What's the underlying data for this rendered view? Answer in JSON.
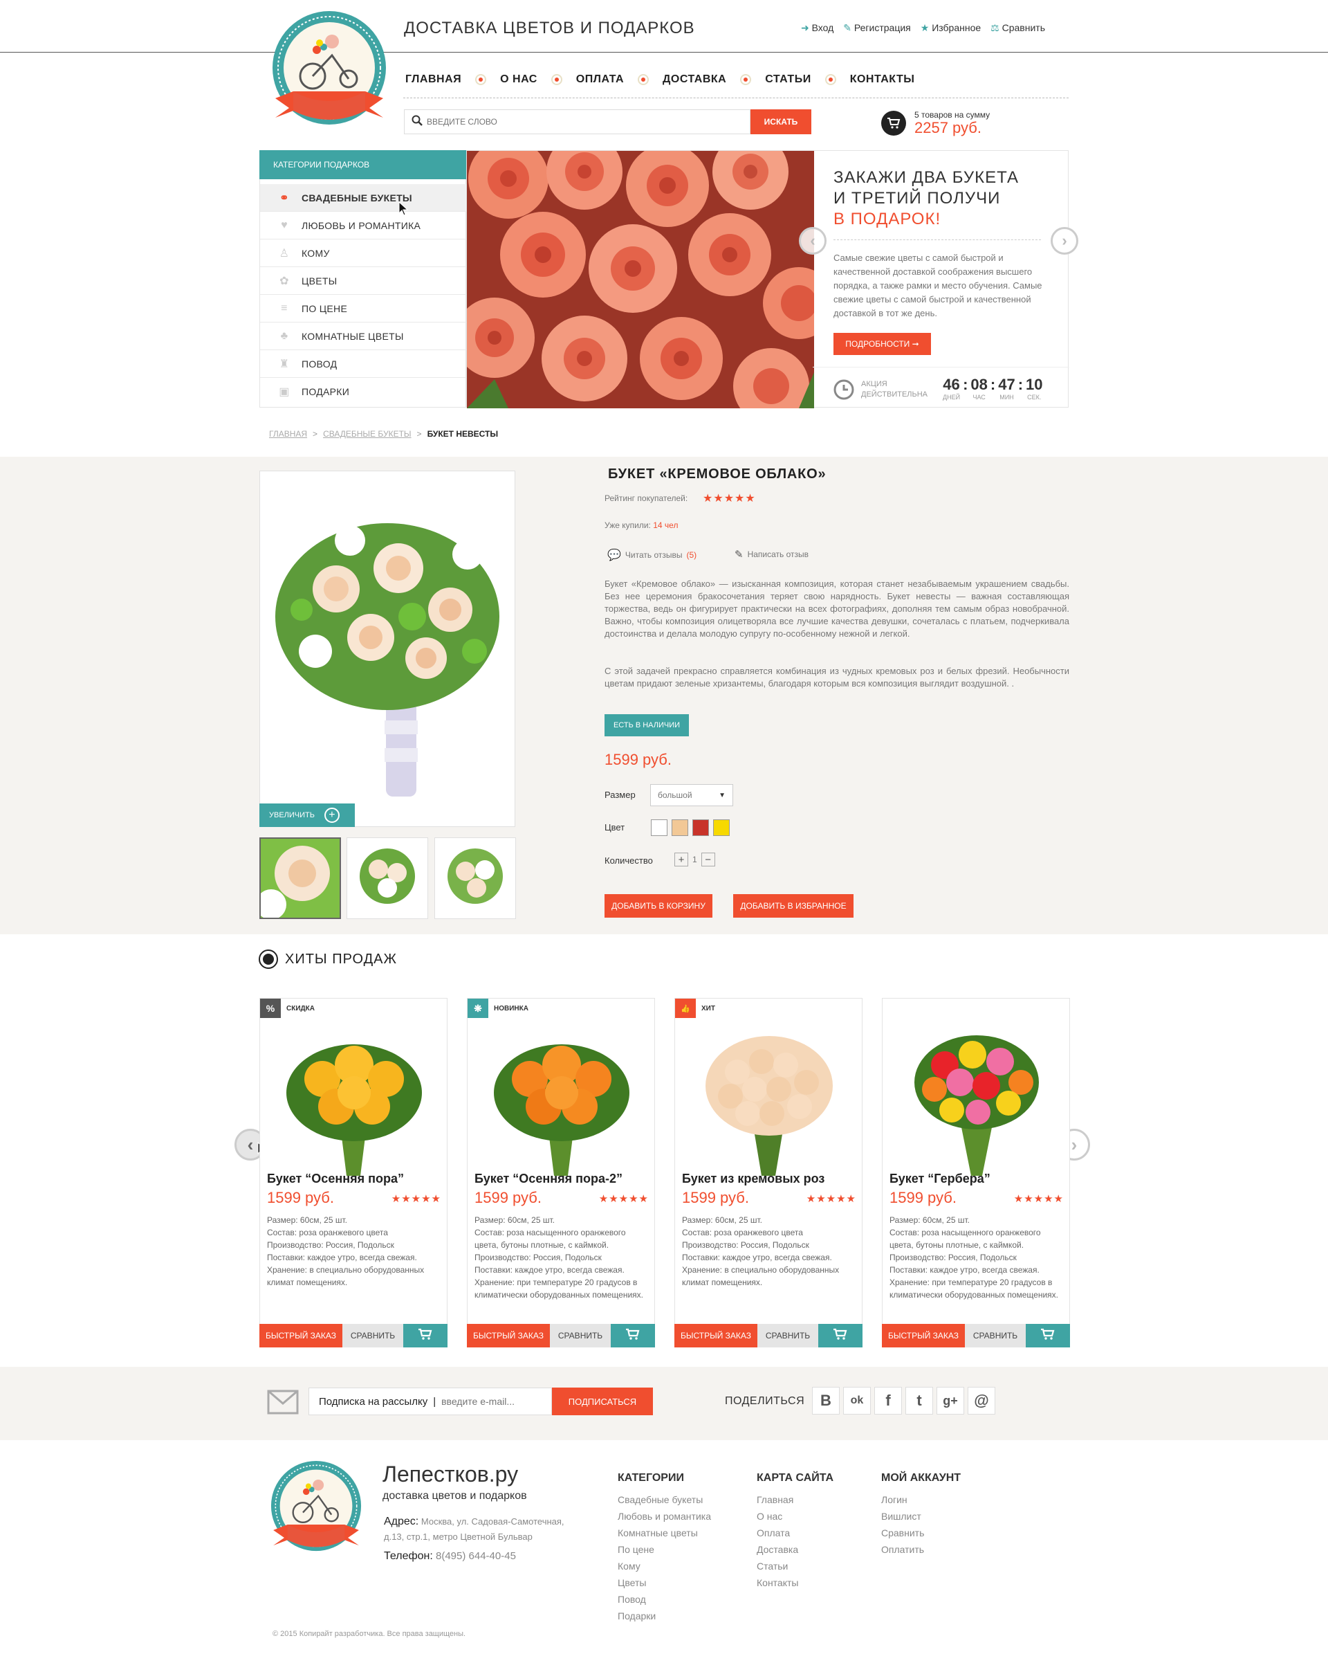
{
  "header": {
    "title": "ДОСТАВКА ЦВЕТОВ И ПОДАРКОВ",
    "links": [
      {
        "label": "Вход",
        "icon": "login-icon"
      },
      {
        "label": "Регистрация",
        "icon": "edit-icon"
      },
      {
        "label": "Избранное",
        "icon": "star-icon"
      },
      {
        "label": "Сравнить",
        "icon": "scales-icon"
      }
    ],
    "logo_text": "Лепестков.ру"
  },
  "nav": [
    "ГЛАВНАЯ",
    "О НАС",
    "ОПЛАТА",
    "ДОСТАВКА",
    "СТАТЬИ",
    "КОНТАКТЫ"
  ],
  "search": {
    "placeholder": "ВВЕДИТЕ СЛОВО",
    "button": "ИСКАТЬ"
  },
  "cart": {
    "summary": "5 товаров на сумму",
    "total": "2257 руб."
  },
  "categories": {
    "title": "КАТЕГОРИИ ПОДАРКОВ",
    "items": [
      "СВАДЕБНЫЕ БУКЕТЫ",
      "ЛЮБОВЬ И РОМАНТИКА",
      "КОМУ",
      "ЦВЕТЫ",
      "ПО ЦЕНЕ",
      "КОМНАТНЫЕ ЦВЕТЫ",
      "ПОВОД",
      "ПОДАРКИ"
    ]
  },
  "promo": {
    "line1": "ЗАКАЖИ ДВА БУКЕТА",
    "line2": "И ТРЕТИЙ ПОЛУЧИ",
    "line3": "В ПОДАРОК!",
    "text": "Самые свежие цветы с самой быстрой и качественной доставкой соображения высшего порядка, а также рамки и место обучения. Самые свежие цветы с самой быстрой и качественной доставкой в тот же день.",
    "button": "ПОДРОБНОСТИ ➞",
    "timer_label1": "АКЦИЯ",
    "timer_label2": "ДЕЙСТВИТЕЛЬНА",
    "days": "46",
    "hours": "08",
    "minutes": "47",
    "seconds": "10",
    "days_label": "ДНЕЙ",
    "hours_label": "ЧАС",
    "minutes_label": "МИН",
    "seconds_label": "СЕК."
  },
  "breadcrumb": {
    "home": "ГЛАВНАЯ",
    "cat": "СВАДЕБНЫЕ БУКЕТЫ",
    "current": "БУКЕТ НЕВЕСТЫ",
    "sep": ">"
  },
  "product": {
    "title": "БУКЕТ «КРЕМОВОЕ ОБЛАКО»",
    "rating_label": "Рейтинг покупателей:",
    "stars": "★★★★★",
    "bought_label": "Уже купили:",
    "bought_value": "14 чел",
    "reviews_label": "Читать отзывы",
    "reviews_count": "(5)",
    "write_review": "Написать отзыв",
    "desc1": "Букет «Кремовое облако» — изысканная композиция, которая станет незабываемым украшением свадьбы. Без нее церемония бракосочетания теряет свою нарядность. Букет невесты — важная составляющая торжества, ведь он фигурирует практически на всех фотографиях, дополняя тем самым образ новобрачной. Важно, чтобы композиция олицетворяла все лучшие качества девушки, сочеталась с платьем, подчеркивала достоинства и делала молодую супругу по-особенному нежной и легкой.",
    "desc2": "С этой задачей прекрасно справляется комбинация из чудных кремовых роз и белых фрезий. Необычности цветам придают зеленые хризантемы, благодаря которым вся композиция выглядит воздушной. .",
    "stock": "ЕСТЬ В НАЛИЧИИ",
    "price": "1599 руб.",
    "size_label": "Размер",
    "size_value": "большой",
    "color_label": "Цвет",
    "colors": [
      "#ffffff",
      "#f2c896",
      "#c8332a",
      "#f7d900"
    ],
    "qty_label": "Количество",
    "qty_plus": "+",
    "qty": "1",
    "qty_minus": "−",
    "add_cart": "ДОБАВИТЬ В КОРЗИНУ",
    "add_fav": "ДОБАВИТЬ В ИЗБРАННОЕ",
    "zoom": "УВЕЛИЧИТЬ"
  },
  "hits": {
    "title": "ХИТЫ ПРОДАЖ",
    "quick": "БЫСТРЫЙ ЗАКАЗ",
    "compare": "СРАВНИТЬ",
    "items": [
      {
        "badge": "СКИДКА",
        "badge_icon": "%",
        "badge_color": "#555555",
        "name": "Букет “Осенняя пора”",
        "price": "1599 руб.",
        "stars": "★★★★★",
        "desc": "Размер: 60см, 25 шт.\nСостав: роза оранжевого цвета\nПроизводство: Россия, Подольск\nПоставки: каждое утро, всегда свежая.\nХранение: в специально оборудованных климат помещениях."
      },
      {
        "badge": "НОВИНКА",
        "badge_icon": "❋",
        "badge_color": "#3fa4a3",
        "name": "Букет “Осенняя пора-2”",
        "price": "1599 руб.",
        "stars": "★★★★★",
        "desc": "Размер: 60см, 25 шт.\nСостав: роза насыщенного оранжевого цвета, бутоны плотные, с каймкой.\nПроизводство: Россия, Подольск\nПоставки: каждое утро, всегда свежая.\nХранение: при температуре 20 градусов в климатически оборудованных помещениях."
      },
      {
        "badge": "ХИТ",
        "badge_icon": "👍",
        "badge_color": "#f04e2f",
        "name": "Букет из кремовых роз",
        "price": "1599 руб.",
        "stars": "★★★★★",
        "desc": "Размер: 60см, 25 шт.\nСостав: роза оранжевого цвета\nПроизводство: Россия, Подольск\nПоставки: каждое утро, всегда свежая.\nХранение: в специально оборудованных климат помещениях."
      },
      {
        "badge": "",
        "badge_icon": "",
        "badge_color": "",
        "name": "Букет “Гербера”",
        "price": "1599 руб.",
        "stars": "★★★★★",
        "desc": "Размер: 60см, 25 шт.\nСостав: роза насыщенного оранжевого цвета, бутоны плотные, с каймкой.\nПроизводство: Россия, Подольск\nПоставки: каждое утро, всегда свежая.\nХранение: при температуре 20 градусов в климатически оборудованных помещениях."
      }
    ]
  },
  "subscribe": {
    "label": "Подписка на рассылку",
    "sep": "|",
    "placeholder": "введите e-mail...",
    "button": "ПОДПИСАТЬСЯ",
    "share": "ПОДЕЛИТЬСЯ",
    "socials": [
      "B",
      "ok",
      "f",
      "t",
      "g+",
      "@"
    ]
  },
  "footer": {
    "brand": "Лепестков.ру",
    "tagline": "доставка цветов и подарков",
    "address_label": "Адрес:",
    "address": "Москва, ул. Садовая-Самотечная, д.13, стр.1, метро Цветной Бульвар",
    "phone_label": "Телефон:",
    "phone": "8(495) 644-40-45",
    "copyright": "© 2015 Копирайт разработчика. Все права защищены.",
    "cols": [
      {
        "title": "КАТЕГОРИИ",
        "links": [
          "Свадебные букеты",
          "Любовь и романтика",
          "Комнатные цветы",
          "По цене",
          "Кому",
          "Цветы",
          "Повод",
          "Подарки"
        ]
      },
      {
        "title": "КАРТА САЙТА",
        "links": [
          "Главная",
          "О нас",
          "Оплата",
          "Доставка",
          "Статьи",
          "Контакты"
        ]
      },
      {
        "title": "МОЙ АККАУНТ",
        "links": [
          "Логин",
          "Вишлист",
          "Сравнить",
          "Оплатить"
        ]
      }
    ]
  }
}
